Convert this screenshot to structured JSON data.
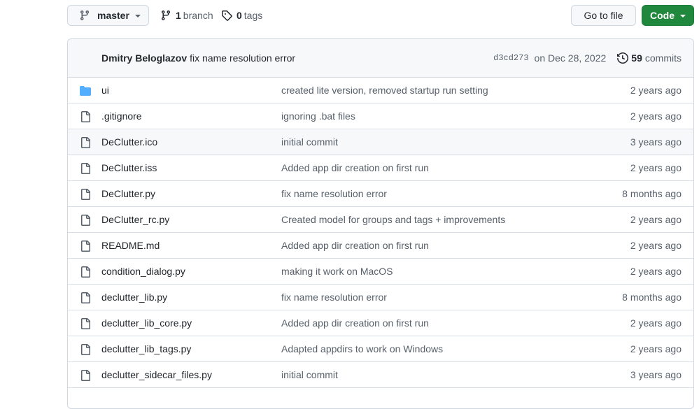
{
  "toolbar": {
    "branch_selector": {
      "label": "master",
      "icon": "git-branch-icon"
    },
    "branches": {
      "count": "1",
      "label": "branch",
      "icon": "git-branch-icon"
    },
    "tags": {
      "count": "0",
      "label": "tags",
      "icon": "tag-icon"
    },
    "go_to_file_label": "Go to file",
    "code_label": "Code"
  },
  "latest_commit": {
    "author": "Dmitry Beloglazov",
    "message": "fix name resolution error",
    "sha": "d3cd273",
    "date": "on Dec 28, 2022",
    "commits_count": "59",
    "commits_label": "commits",
    "icon": "history-icon"
  },
  "colors": {
    "accent_green": "#1f883d",
    "folder_blue": "#54aeff",
    "muted_text": "#57606a",
    "border": "#d0d7de",
    "header_bg": "#f6f8fa"
  },
  "files": [
    {
      "type": "dir",
      "name": "ui",
      "message": "created lite version, removed startup run setting",
      "age": "2 years ago"
    },
    {
      "type": "file",
      "name": ".gitignore",
      "message": "ignoring .bat files",
      "age": "2 years ago"
    },
    {
      "type": "file",
      "name": "DeClutter.ico",
      "message": "initial commit",
      "age": "3 years ago",
      "hover": true
    },
    {
      "type": "file",
      "name": "DeClutter.iss",
      "message": "Added app dir creation on first run",
      "age": "2 years ago"
    },
    {
      "type": "file",
      "name": "DeClutter.py",
      "message": "fix name resolution error",
      "age": "8 months ago"
    },
    {
      "type": "file",
      "name": "DeClutter_rc.py",
      "message": "Created model for groups and tags + improvements",
      "age": "2 years ago"
    },
    {
      "type": "file",
      "name": "README.md",
      "message": "Added app dir creation on first run",
      "age": "2 years ago"
    },
    {
      "type": "file",
      "name": "condition_dialog.py",
      "message": "making it work on MacOS",
      "age": "2 years ago"
    },
    {
      "type": "file",
      "name": "declutter_lib.py",
      "message": "fix name resolution error",
      "age": "8 months ago"
    },
    {
      "type": "file",
      "name": "declutter_lib_core.py",
      "message": "Added app dir creation on first run",
      "age": "2 years ago"
    },
    {
      "type": "file",
      "name": "declutter_lib_tags.py",
      "message": "Adapted appdirs to work on Windows",
      "age": "2 years ago"
    },
    {
      "type": "file",
      "name": "declutter_sidecar_files.py",
      "message": "initial commit",
      "age": "3 years ago"
    }
  ]
}
